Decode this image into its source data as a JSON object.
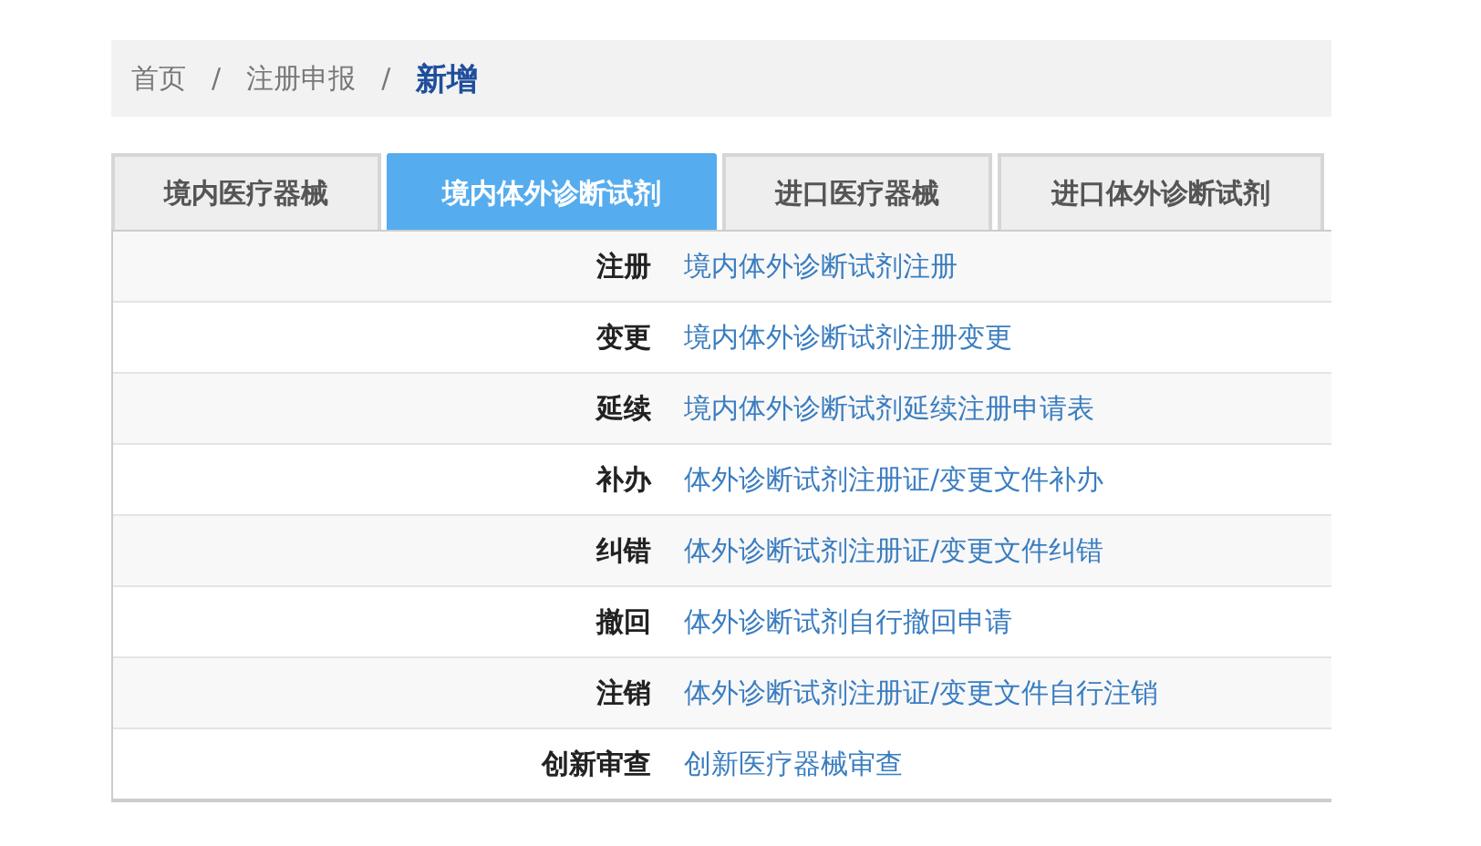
{
  "breadcrumb": [
    {
      "kind": "link",
      "label": "首页",
      "current": false
    },
    {
      "label": "/",
      "kind": "separator"
    },
    {
      "kind": "link",
      "label": "注册申报",
      "current": false
    },
    {
      "label": "/",
      "kind": "separator"
    },
    {
      "kind": "link",
      "label": "新增",
      "current": true
    }
  ],
  "tabs": [
    {
      "label": "境内医疗器械",
      "selected": false
    },
    {
      "label": "境内体外诊断试剂",
      "selected": true
    },
    {
      "label": "进口医疗器械",
      "selected": false
    },
    {
      "label": "进口体外诊断试剂",
      "selected": false
    }
  ],
  "rows": [
    {
      "label": "注册",
      "link": "境内体外诊断试剂注册"
    },
    {
      "label": "变更",
      "link": "境内体外诊断试剂注册变更"
    },
    {
      "label": "延续",
      "link": "境内体外诊断试剂延续注册申请表"
    },
    {
      "label": "补办",
      "link": "体外诊断试剂注册证/变更文件补办"
    },
    {
      "label": "纠错",
      "link": "体外诊断试剂注册证/变更文件纠错"
    },
    {
      "label": "撤回",
      "link": "体外诊断试剂自行撤回申请"
    },
    {
      "label": "注销",
      "link": "体外诊断试剂注册证/变更文件自行注销"
    },
    {
      "label": "创新审查",
      "link": "创新医疗器械审查"
    }
  ]
}
